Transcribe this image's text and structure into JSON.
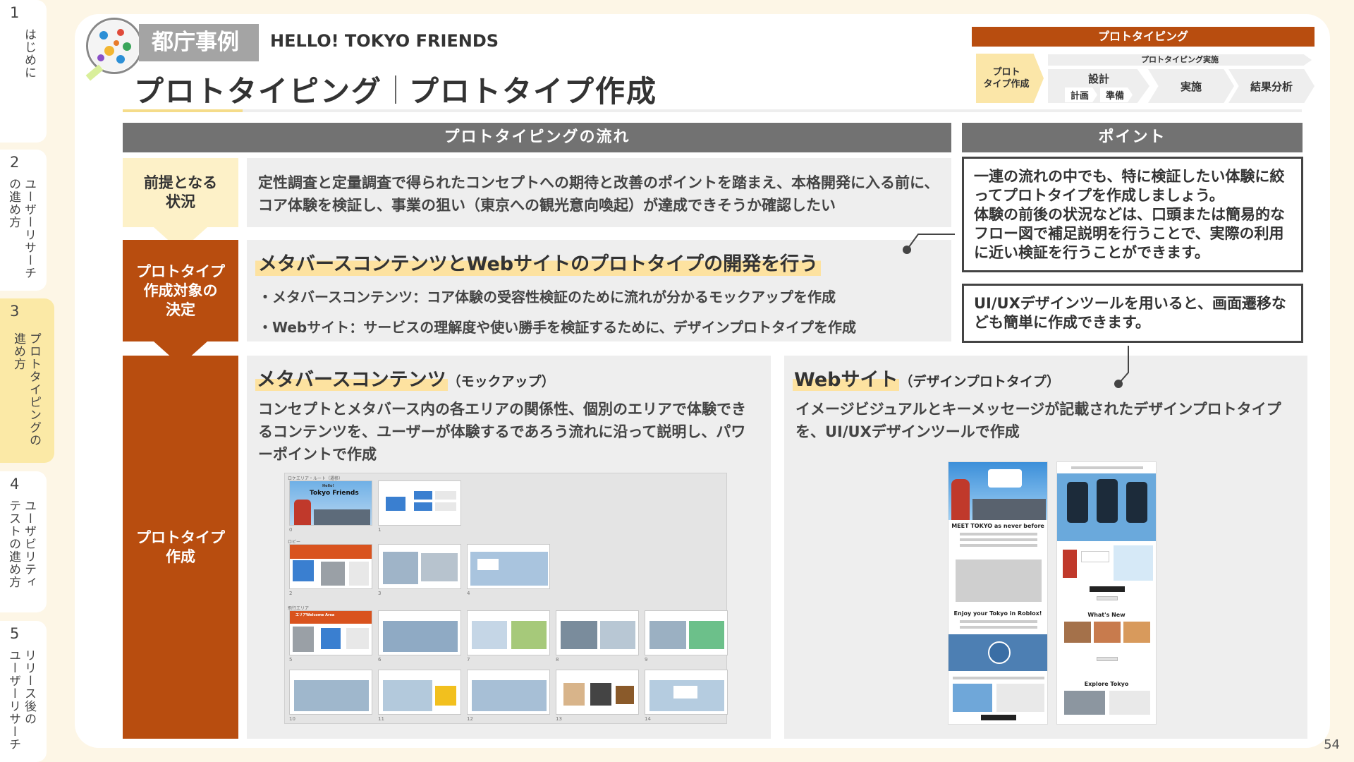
{
  "side_tabs": [
    {
      "num": "1",
      "label": "はじめに"
    },
    {
      "num": "2",
      "label": "ユーザーリサーチ\nの進め方"
    },
    {
      "num": "3",
      "label": "プロトタイピングの\n進め方"
    },
    {
      "num": "4",
      "label": "ユーザビリティ\nテストの進め方"
    },
    {
      "num": "5",
      "label": "リリース後の\nユーザーリサーチ"
    }
  ],
  "header": {
    "case_label": "都庁事例",
    "case_name": "HELLO! TOKYO FRIENDS",
    "title_left": "プロトタイピング",
    "title_right": "プロトタイプ作成"
  },
  "process": {
    "header": "プロトタイピング",
    "start": "プロト\nタイプ作成",
    "run_label": "プロトタイピング実施",
    "design": "設計",
    "plan": "計画",
    "prepare": "準備",
    "execute": "実施",
    "analysis": "結果分析"
  },
  "flow": {
    "header": "プロトタイピングの流れ",
    "premise_label": "前提となる\n状況",
    "premise_text": "定性調査と定量調査で得られたコンセプトへの期待と改善のポイントを踏まえ、本格開発に入る前に、コア体験を検証し、事業の狙い（東京への観光意向喚起）が達成できそうか確認したい",
    "decision_label": "プロトタイプ\n作成対象の\n決定",
    "decision_title": "メタバースコンテンツとWebサイトのプロトタイプの開発を行う",
    "decision_bullets": [
      "・メタバースコンテンツ：コア体験の受容性検証のために流れが分かるモックアップを作成",
      "・Webサイト：サービスの理解度や使い勝手を検証するために、デザインプロトタイプを作成"
    ],
    "creation_label": "プロトタイプ\n作成",
    "metaverse": {
      "title": "メタバースコンテンツ",
      "title_note": "（モックアップ）",
      "text": "コンセプトとメタバース内の各エリアの関係性、個別のエリアで体験できるコンテンツを、ユーザーが体験するであろう流れに沿って説明し、パワーポイントで作成",
      "thumb_title": "Tokyo Friends",
      "thumb_badge": "Hello!",
      "thumb_label": "エリアWelcome Area",
      "row_labels": [
        "ロケエリア・ルート（遷移）",
        "ロビー",
        "飛行エリア"
      ]
    },
    "website": {
      "title": "Webサイト",
      "title_note": "（デザインプロトタイプ）",
      "text": "イメージビジュアルとキーメッセージが記載されたデザインプロトタイプを、UI/UXデザインツールで作成",
      "mock_headline1": "MEET TOKYO as never before",
      "mock_headline2": "Enjoy your Tokyo in Roblox!",
      "mock_whats_new": "What's New",
      "mock_explore": "Explore Tokyo"
    }
  },
  "points": {
    "header": "ポイント",
    "point1": "一連の流れの中でも、特に検証したい体験に絞ってプロトタイプを作成しましょう。\n体験の前後の状況などは、口頭または簡易的なフロー図で補足説明を行うことで、実際の利用に近い検証を行うことができます。",
    "point2": "UI/UXデザインツールを用いると、画面遷移なども簡単に作成できます。"
  },
  "page_number": "54"
}
